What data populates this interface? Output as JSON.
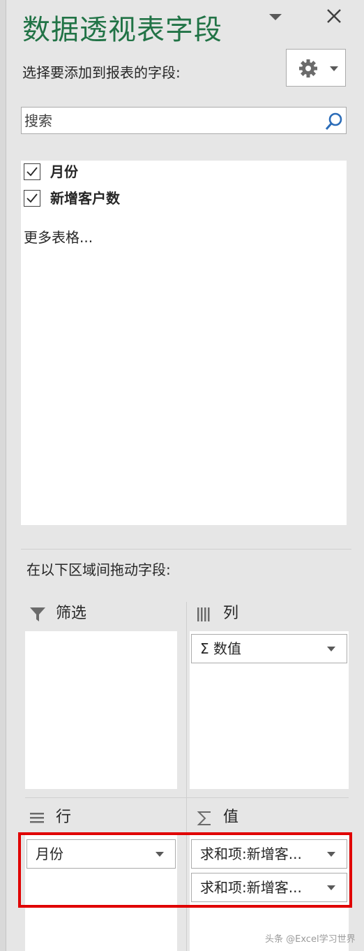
{
  "panel": {
    "title": "数据透视表字段",
    "subtitle": "选择要添加到报表的字段:",
    "title_color": "#217346"
  },
  "search": {
    "placeholder": "搜索",
    "value": ""
  },
  "fields": [
    {
      "label": "月份",
      "checked": true
    },
    {
      "label": "新增客户数",
      "checked": true
    }
  ],
  "more_tables": "更多表格...",
  "areas": {
    "instruction": "在以下区域间拖动字段:",
    "filter": {
      "label": "筛选",
      "icon": "filter-icon",
      "items": []
    },
    "columns": {
      "label": "列",
      "icon": "columns-icon",
      "items": [
        "Σ  数值"
      ]
    },
    "rows": {
      "label": "行",
      "icon": "rows-icon",
      "items": [
        "月份"
      ]
    },
    "values": {
      "label": "值",
      "icon": "sigma-icon",
      "items": [
        "求和项:新增客...",
        "求和项:新增客..."
      ]
    }
  },
  "highlight_color": "#e00000",
  "watermark": "头条 @Excel学习世界"
}
